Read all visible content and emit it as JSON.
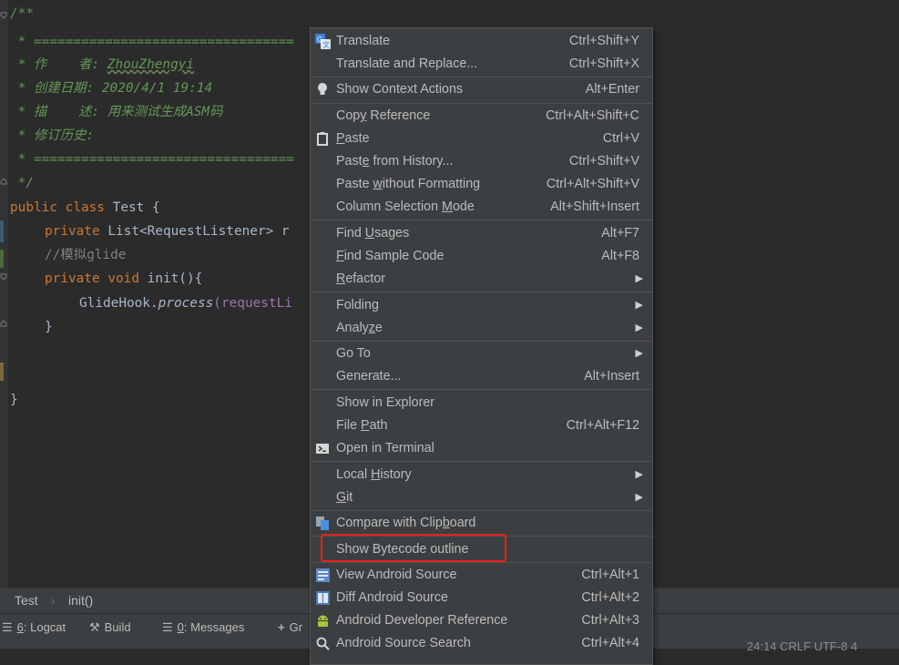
{
  "code": {
    "lines": [
      "/**",
      " * =================================",
      " * 作    者:",
      "ZhouZhengyi",
      " * 创建日期: 2020/4/1 19:14",
      " * 描    述: 用来测试生成ASM码",
      " * 修订历史:",
      " * =================================",
      " */",
      "public",
      "class",
      "Test {",
      "private",
      "List<RequestListener> r",
      "//模拟glide",
      "private",
      "void",
      "init(){",
      "GlideHook.",
      "process",
      "(requestLi",
      "}",
      "}"
    ]
  },
  "breadcrumb": {
    "file": "Test",
    "separator": "›",
    "method": "init()"
  },
  "toolwindows": [
    {
      "mnemonic": "6",
      "rest": ": Logcat",
      "icon": "logcat-icon"
    },
    {
      "label": "Build",
      "icon": "build-icon"
    },
    {
      "mnemonic": "0",
      "rest": ": Messages",
      "icon": "messages-icon"
    },
    {
      "label": "Gr",
      "icon": "add-icon"
    }
  ],
  "status_right": "24:14   CRLF   UTF-8   4",
  "menu": {
    "items": [
      {
        "pre": "Translate",
        "mn": "",
        "post": "",
        "shortcut": "Ctrl+Shift+Y",
        "icon": "translate-icon"
      },
      {
        "pre": "Translate and Replace...",
        "mn": "",
        "post": "",
        "shortcut": "Ctrl+Shift+X"
      },
      {
        "pre": "Show Context Actions",
        "mn": "",
        "post": "",
        "shortcut": "Alt+Enter",
        "icon": "lightbulb-icon"
      },
      {
        "pre": "Cop",
        "mn": "y",
        "post": " Reference",
        "shortcut": "Ctrl+Alt+Shift+C"
      },
      {
        "pre": "",
        "mn": "P",
        "post": "aste",
        "shortcut": "Ctrl+V",
        "icon": "paste-icon"
      },
      {
        "pre": "Past",
        "mn": "e",
        "post": " from History...",
        "shortcut": "Ctrl+Shift+V"
      },
      {
        "pre": "Paste ",
        "mn": "w",
        "post": "ithout Formatting",
        "shortcut": "Ctrl+Alt+Shift+V"
      },
      {
        "pre": "Column Selection ",
        "mn": "M",
        "post": "ode",
        "shortcut": "Alt+Shift+Insert"
      },
      {
        "pre": "Find ",
        "mn": "U",
        "post": "sages",
        "shortcut": "Alt+F7"
      },
      {
        "pre": "",
        "mn": "F",
        "post": "ind Sample Code",
        "shortcut": "Alt+F8"
      },
      {
        "pre": "",
        "mn": "R",
        "post": "efactor",
        "shortcut": "",
        "submenu": true
      },
      {
        "pre": "Folding",
        "mn": "",
        "post": "",
        "shortcut": "",
        "submenu": true
      },
      {
        "pre": "Analy",
        "mn": "z",
        "post": "e",
        "shortcut": "",
        "submenu": true
      },
      {
        "pre": "Go To",
        "mn": "",
        "post": "",
        "shortcut": "",
        "submenu": true
      },
      {
        "pre": "Generate...",
        "mn": "",
        "post": "",
        "shortcut": "Alt+Insert"
      },
      {
        "pre": "Show in Explorer",
        "mn": "",
        "post": "",
        "shortcut": ""
      },
      {
        "pre": "File ",
        "mn": "P",
        "post": "ath",
        "shortcut": "Ctrl+Alt+F12"
      },
      {
        "pre": "Open in Terminal",
        "mn": "",
        "post": "",
        "shortcut": "",
        "icon": "terminal-icon"
      },
      {
        "pre": "Local ",
        "mn": "H",
        "post": "istory",
        "shortcut": "",
        "submenu": true
      },
      {
        "pre": "",
        "mn": "G",
        "post": "it",
        "shortcut": "",
        "submenu": true
      },
      {
        "pre": "Compare with Clip",
        "mn": "b",
        "post": "oard",
        "shortcut": "",
        "icon": "compare-icon"
      },
      {
        "pre": "Show Bytecode outline",
        "mn": "",
        "post": "",
        "shortcut": ""
      },
      {
        "pre": "View Android Source",
        "mn": "",
        "post": "",
        "shortcut": "Ctrl+Alt+1",
        "icon": "android-source-icon"
      },
      {
        "pre": "Diff Android Source",
        "mn": "",
        "post": "",
        "shortcut": "Ctrl+Alt+2",
        "icon": "diff-icon"
      },
      {
        "pre": "Android Developer Reference",
        "mn": "",
        "post": "",
        "shortcut": "Ctrl+Alt+3",
        "icon": "android-icon"
      },
      {
        "pre": "Android Source Search",
        "mn": "",
        "post": "",
        "shortcut": "Ctrl+Alt+4",
        "icon": "search-icon"
      }
    ]
  },
  "colors": {
    "editor_bg": "#2b2b2b",
    "menu_bg": "#3c3f41",
    "comment": "#629755",
    "keyword": "#cc7832",
    "field": "#9876aa",
    "highlight": "#e8201c"
  }
}
